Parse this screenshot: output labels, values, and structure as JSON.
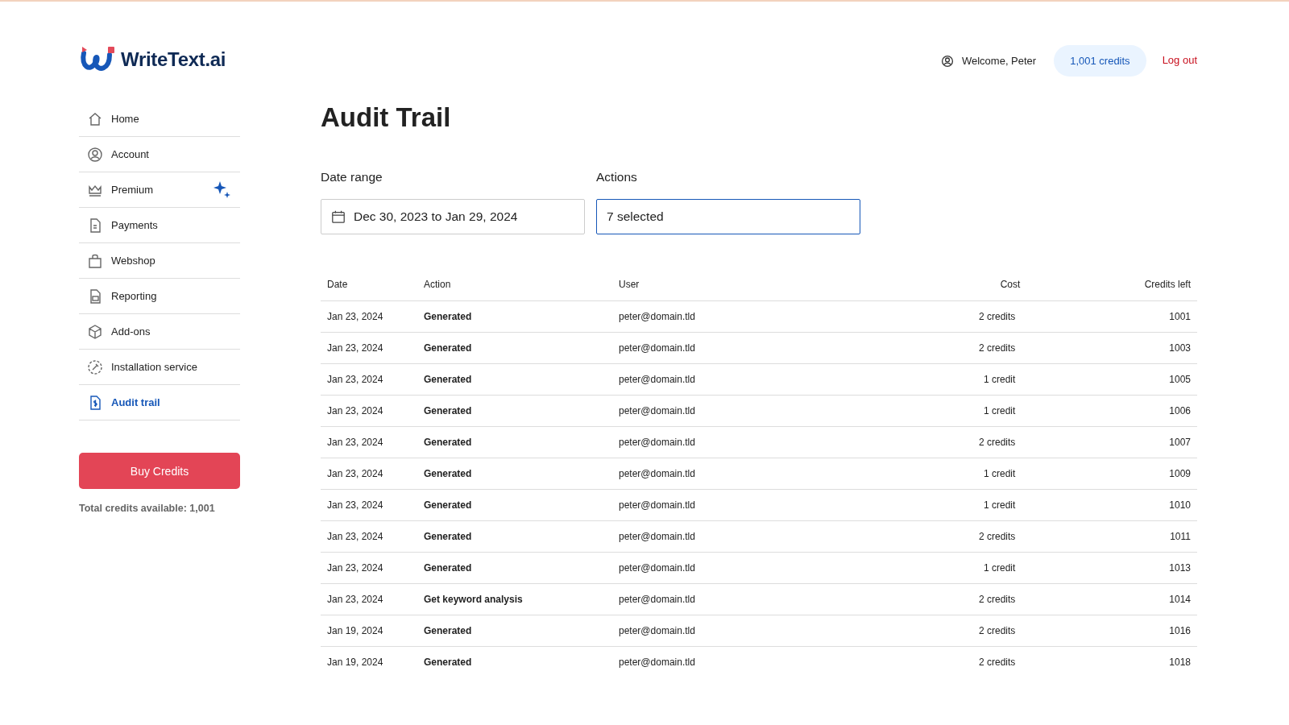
{
  "logo": {
    "text": "WriteText.ai"
  },
  "header": {
    "welcome": "Welcome, Peter",
    "credits": "1,001 credits",
    "logout": "Log out"
  },
  "sidebar": {
    "items": [
      {
        "label": "Home",
        "selected": false,
        "sparkle": false
      },
      {
        "label": "Account",
        "selected": false,
        "sparkle": false
      },
      {
        "label": "Premium",
        "selected": false,
        "sparkle": true
      },
      {
        "label": "Payments",
        "selected": false,
        "sparkle": false
      },
      {
        "label": "Webshop",
        "selected": false,
        "sparkle": false
      },
      {
        "label": "Reporting",
        "selected": false,
        "sparkle": false
      },
      {
        "label": "Add-ons",
        "selected": false,
        "sparkle": false
      },
      {
        "label": "Installation service",
        "selected": false,
        "sparkle": false
      },
      {
        "label": "Audit trail",
        "selected": true,
        "sparkle": false
      }
    ],
    "buy_button": "Buy Credits",
    "total": "Total credits available: 1,001"
  },
  "page_title": "Audit Trail",
  "filters": {
    "date_label": "Date range",
    "date_value": "Dec 30, 2023 to Jan 29, 2024",
    "actions_label": "Actions",
    "actions_value": "7 selected"
  },
  "table": {
    "columns": [
      "Date",
      "Action",
      "User",
      "Cost",
      "Credits left"
    ],
    "rows": [
      [
        "Jan 23, 2024",
        "Generated",
        "peter@domain.tld",
        "2 credits",
        "1001"
      ],
      [
        "Jan 23, 2024",
        "Generated",
        "peter@domain.tld",
        "2 credits",
        "1003"
      ],
      [
        "Jan 23, 2024",
        "Generated",
        "peter@domain.tld",
        "1 credit",
        "1005"
      ],
      [
        "Jan 23, 2024",
        "Generated",
        "peter@domain.tld",
        "1 credit",
        "1006"
      ],
      [
        "Jan 23, 2024",
        "Generated",
        "peter@domain.tld",
        "2 credits",
        "1007"
      ],
      [
        "Jan 23, 2024",
        "Generated",
        "peter@domain.tld",
        "1 credit",
        "1009"
      ],
      [
        "Jan 23, 2024",
        "Generated",
        "peter@domain.tld",
        "1 credit",
        "1010"
      ],
      [
        "Jan 23, 2024",
        "Generated",
        "peter@domain.tld",
        "2 credits",
        "1011"
      ],
      [
        "Jan 23, 2024",
        "Generated",
        "peter@domain.tld",
        "1 credit",
        "1013"
      ],
      [
        "Jan 23, 2024",
        "Get keyword analysis",
        "peter@domain.tld",
        "2 credits",
        "1014"
      ],
      [
        "Jan 19, 2024",
        "Generated",
        "peter@domain.tld",
        "2 credits",
        "1016"
      ],
      [
        "Jan 19, 2024",
        "Generated",
        "peter@domain.tld",
        "2 credits",
        "1018"
      ]
    ]
  }
}
